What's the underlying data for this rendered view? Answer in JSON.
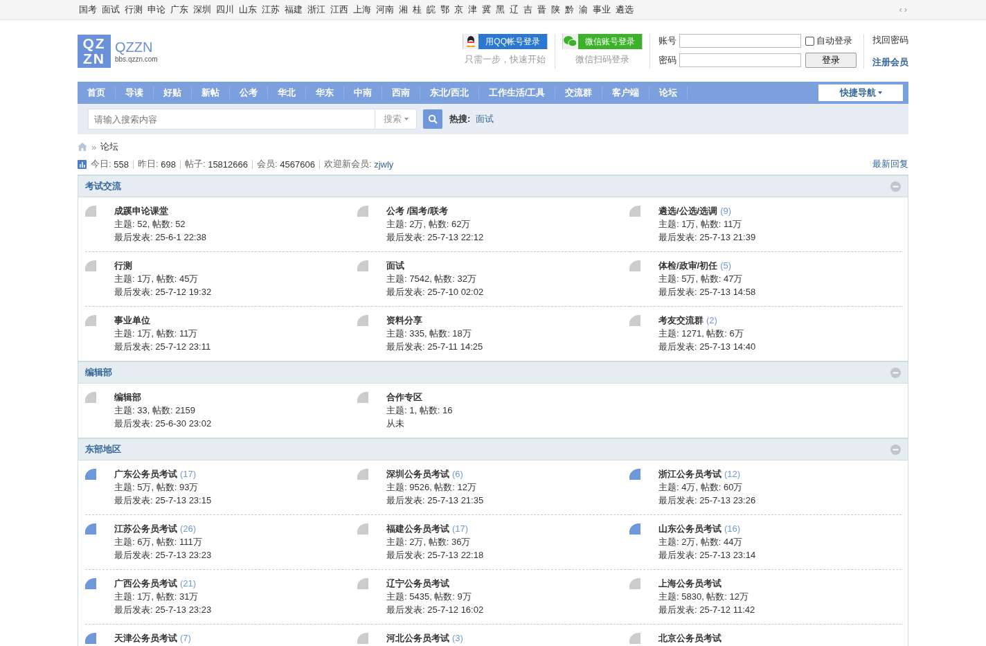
{
  "topbar": {
    "links": [
      "国考",
      "面试",
      "行测",
      "申论",
      "广东",
      "深圳",
      "四川",
      "山东",
      "江苏",
      "福建",
      "浙江",
      "江西",
      "上海",
      "河南",
      "湘",
      "桂",
      "皖",
      "鄂",
      "京",
      "津",
      "冀",
      "黑",
      "辽",
      "吉",
      "晋",
      "陕",
      "黔",
      "渝",
      "事业",
      "遴选"
    ],
    "arrows": "‹ ›"
  },
  "logo": {
    "mark_top": "QZ",
    "mark_bottom": "ZN",
    "name": "QZZN",
    "domain": "bbs.qzzn.com"
  },
  "login": {
    "qq_button": "用QQ帐号登录",
    "qq_hint": "只需一步，快速开始",
    "wechat_button": "微信账号登录",
    "wechat_hint": "微信扫码登录",
    "account_label": "账号",
    "password_label": "密码",
    "auto_login": "自动登录",
    "auto_login_checked": false,
    "submit": "登录",
    "forgot": "找回密码",
    "register": "注册会员"
  },
  "nav": {
    "items": [
      {
        "label": "首页"
      },
      {
        "label": "导读"
      },
      {
        "label": "好贴"
      },
      {
        "label": "新帖"
      },
      {
        "label": "公考"
      },
      {
        "label": "华北"
      },
      {
        "label": "华东"
      },
      {
        "label": "中南"
      },
      {
        "label": "西南"
      },
      {
        "label": "东北/西北"
      },
      {
        "label": "工作生活/工具"
      },
      {
        "label": "交流群"
      },
      {
        "label": "客户端"
      },
      {
        "label": "论坛"
      }
    ],
    "quick": "快捷导航"
  },
  "search": {
    "placeholder": "请输入搜索内容",
    "type": "搜索",
    "hot_label": "热搜:",
    "hot": [
      "面试"
    ]
  },
  "breadcrumb_separator": "»",
  "breadcrumb": [
    "论坛"
  ],
  "stats": [
    {
      "label": "今日:",
      "value": "558"
    },
    {
      "label": "昨日:",
      "value": "698"
    },
    {
      "label": "帖子:",
      "value": "15812666"
    },
    {
      "label": "会员:",
      "value": "4567606"
    }
  ],
  "welcome": {
    "label": "欢迎新会员:",
    "user": "zjwly"
  },
  "latest_replies": "最新回复",
  "sections": [
    {
      "title": "考试交流",
      "forums": [
        {
          "name": "成蹊申论课堂",
          "new": false,
          "stats": "主题: 52, 帖数: 52",
          "last": "最后发表: 25-6-1 22:38"
        },
        {
          "name": "公考 /国考/联考",
          "new": false,
          "stats": "主题: 2万, 帖数: 62万",
          "last": "最后发表: 25-7-13 22:12"
        },
        {
          "name": "遴选/公选/选调",
          "count": "(9)",
          "new": false,
          "stats": "主题: 1万, 帖数: 11万",
          "last": "最后发表: 25-7-13 21:39"
        },
        {
          "name": "行测",
          "new": false,
          "stats": "主题: 1万, 帖数: 45万",
          "last": "最后发表: 25-7-12 19:32"
        },
        {
          "name": "面试",
          "new": false,
          "stats": "主题: 7542, 帖数: 32万",
          "last": "最后发表: 25-7-10 02:02"
        },
        {
          "name": "体检/政审/初任",
          "count": "(5)",
          "new": false,
          "stats": "主题: 5万, 帖数: 47万",
          "last": "最后发表: 25-7-13 14:58"
        },
        {
          "name": "事业单位",
          "new": false,
          "stats": "主题: 1万, 帖数: 11万",
          "last": "最后发表: 25-7-12 23:11"
        },
        {
          "name": "资料分享",
          "new": false,
          "stats": "主题: 335, 帖数: 18万",
          "last": "最后发表: 25-7-11 14:25"
        },
        {
          "name": "考友交流群",
          "count": "(2)",
          "new": false,
          "stats": "主题: 1271, 帖数: 6万",
          "last": "最后发表: 25-7-13 14:40"
        }
      ]
    },
    {
      "title": "编辑部",
      "forums": [
        {
          "name": "编辑部",
          "new": false,
          "stats": "主题: 33, 帖数: 2159",
          "last": "最后发表: 25-6-30 23:02"
        },
        {
          "name": "合作专区",
          "new": false,
          "stats": "主题: 1, 帖数: 16",
          "last": "从未"
        }
      ]
    },
    {
      "title": "东部地区",
      "forums": [
        {
          "name": "广东公务员考试",
          "count": "(17)",
          "new": true,
          "stats": "主题: 5万, 帖数: 93万",
          "last": "最后发表: 25-7-13 23:15"
        },
        {
          "name": "深圳公务员考试",
          "count": "(6)",
          "new": false,
          "stats": "主题: 9526, 帖数: 12万",
          "last": "最后发表: 25-7-13 21:35"
        },
        {
          "name": "浙江公务员考试",
          "count": "(12)",
          "new": true,
          "stats": "主题: 4万, 帖数: 60万",
          "last": "最后发表: 25-7-13 23:26"
        },
        {
          "name": "江苏公务员考试",
          "count": "(26)",
          "new": true,
          "stats": "主题: 6万, 帖数: 111万",
          "last": "最后发表: 25-7-13 23:23"
        },
        {
          "name": "福建公务员考试",
          "count": "(17)",
          "new": false,
          "stats": "主题: 2万, 帖数: 36万",
          "last": "最后发表: 25-7-13 22:18"
        },
        {
          "name": "山东公务员考试",
          "count": "(16)",
          "new": true,
          "stats": "主题: 2万, 帖数: 44万",
          "last": "最后发表: 25-7-13 23:14"
        },
        {
          "name": "广西公务员考试",
          "count": "(21)",
          "new": true,
          "stats": "主题: 1万, 帖数: 31万",
          "last": "最后发表: 25-7-13 23:23"
        },
        {
          "name": "辽宁公务员考试",
          "new": false,
          "stats": "主题: 5435, 帖数: 9万",
          "last": "最后发表: 25-7-12 16:02"
        },
        {
          "name": "上海公务员考试",
          "new": false,
          "stats": "主题: 5830, 帖数: 12万",
          "last": "最后发表: 25-7-12 11:42"
        },
        {
          "name": "天津公务员考试",
          "count": "(7)",
          "new": true
        },
        {
          "name": "河北公务员考试",
          "count": "(3)",
          "new": false
        },
        {
          "name": "北京公务员考试",
          "new": false
        }
      ]
    }
  ]
}
